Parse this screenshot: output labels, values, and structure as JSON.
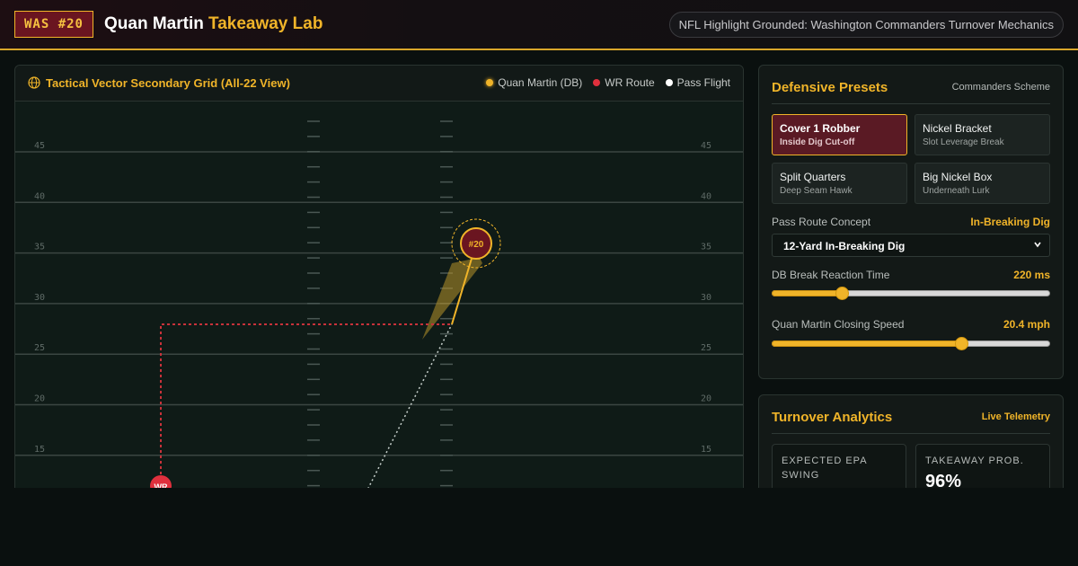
{
  "header": {
    "badge": "WAS #20",
    "name": "Quan Martin",
    "lab": "Takeaway Lab",
    "pill": "NFL Highlight Grounded: Washington Commanders Turnover Mechanics"
  },
  "field": {
    "title": "Tactical Vector Secondary Grid (All-22 View)",
    "legend": [
      {
        "label": "Quan Martin (DB)",
        "color": "#f0b429"
      },
      {
        "label": "WR Route",
        "color": "#e0303d"
      },
      {
        "label": "Pass Flight",
        "color": "#ffffff"
      }
    ],
    "yard_labels": [
      "45",
      "40",
      "35",
      "30",
      "25",
      "20",
      "15"
    ],
    "db_marker": "#20",
    "wr_marker": "WR"
  },
  "presets": {
    "title": "Defensive Presets",
    "scheme": "Commanders Scheme",
    "items": [
      {
        "name": "Cover 1 Robber",
        "desc": "Inside Dig Cut-off",
        "active": true
      },
      {
        "name": "Nickel Bracket",
        "desc": "Slot Leverage Break",
        "active": false
      },
      {
        "name": "Split Quarters",
        "desc": "Deep Seam Hawk",
        "active": false
      },
      {
        "name": "Big Nickel Box",
        "desc": "Underneath Lurk",
        "active": false
      }
    ],
    "route_label": "Pass Route Concept",
    "route_value": "In-Breaking Dig",
    "route_select": "12-Yard In-Breaking Dig",
    "reaction_label": "DB Break Reaction Time",
    "reaction_value": "220 ms",
    "reaction_fraction": 0.25,
    "speed_label": "Quan Martin Closing Speed",
    "speed_value": "20.4 mph",
    "speed_fraction": 0.68
  },
  "analytics": {
    "title": "Turnover Analytics",
    "sub": "Live Telemetry",
    "stats": [
      {
        "label": "EXPECTED EPA SWING",
        "value": ""
      },
      {
        "label": "TAKEAWAY PROB.",
        "value": "96%"
      }
    ]
  },
  "colors": {
    "accent": "#f0b429",
    "wr": "#e0303d",
    "burgundy": "#5a1a24"
  }
}
